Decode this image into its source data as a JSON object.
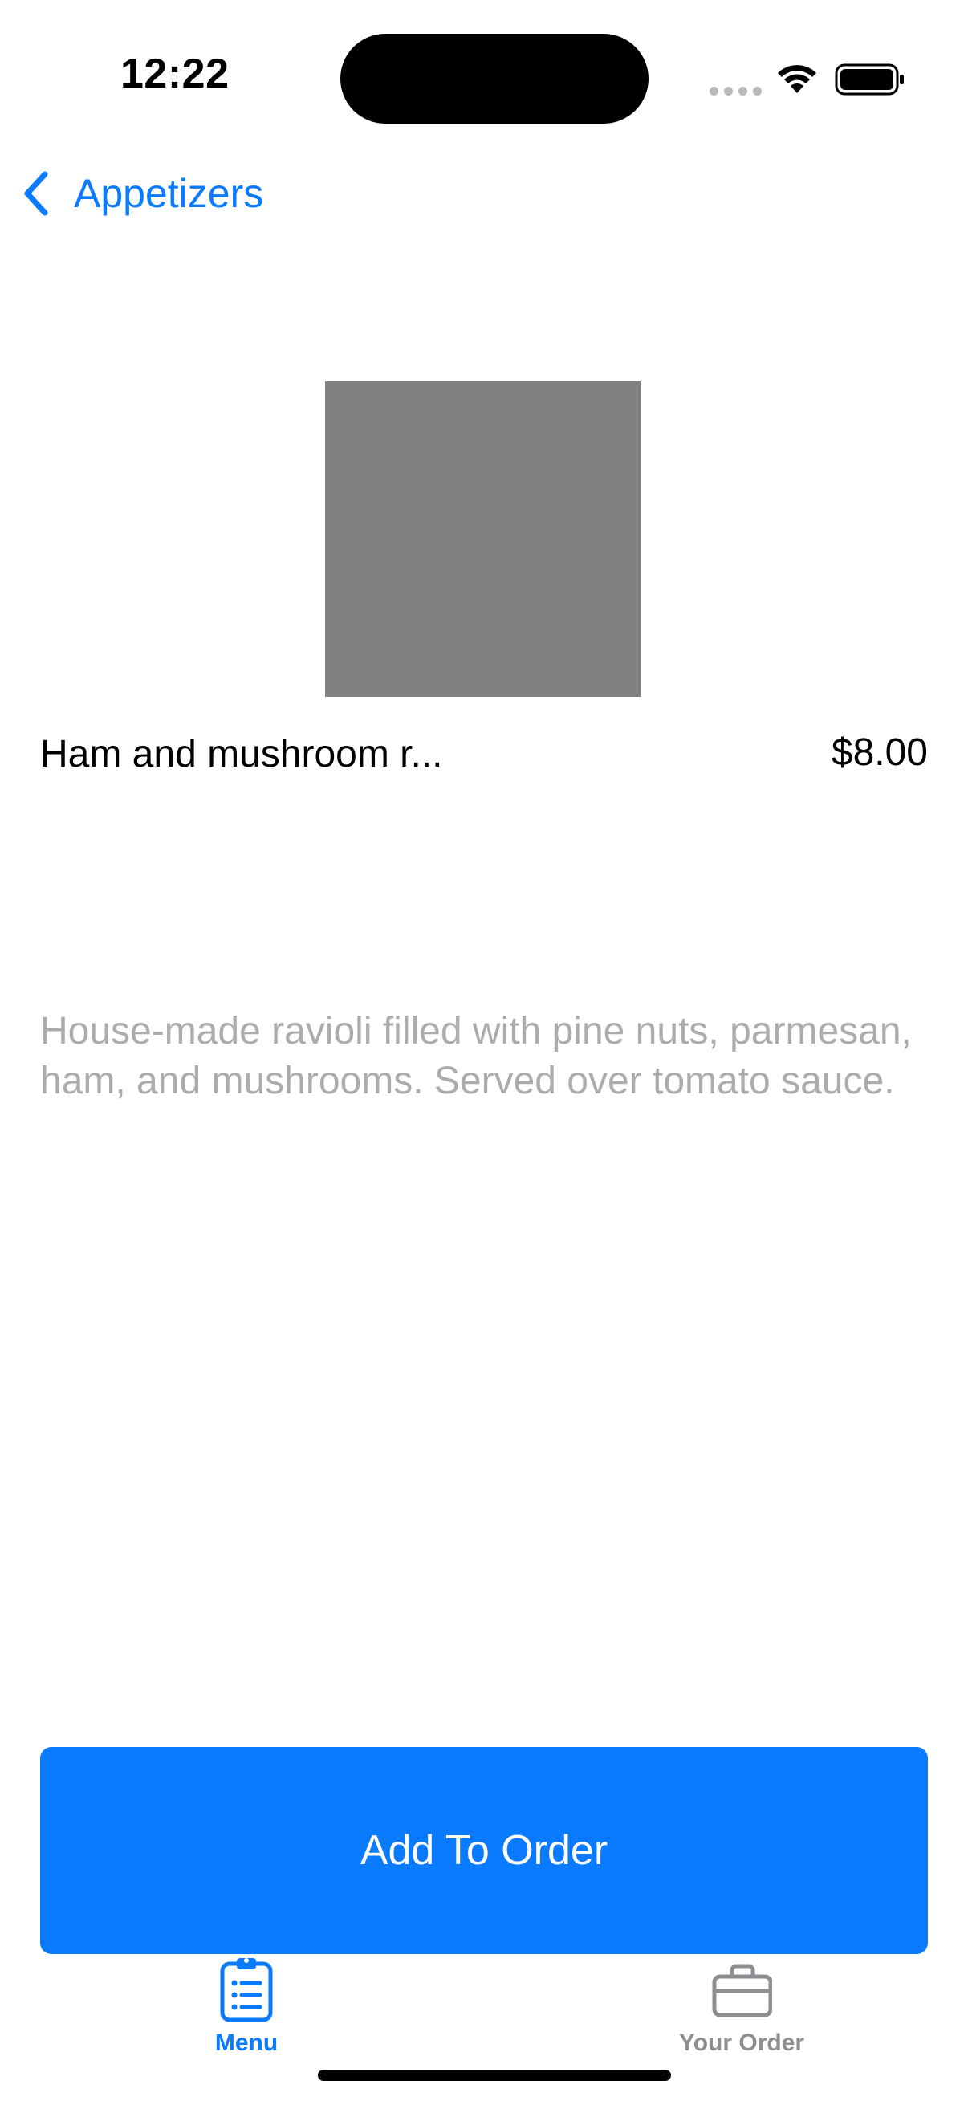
{
  "status_bar": {
    "time": "12:22"
  },
  "nav": {
    "back_label": "Appetizers"
  },
  "product": {
    "name": "Ham and mushroom r...",
    "price": "$8.00",
    "description": "House-made ravioli filled with pine nuts, parmesan, ham, and mushrooms. Served over tomato sauce."
  },
  "actions": {
    "add_label": "Add To Order"
  },
  "tab_bar": {
    "tabs": [
      {
        "label": "Menu",
        "icon": "clipboard-list-icon",
        "selected": true
      },
      {
        "label": "Your Order",
        "icon": "briefcase-icon",
        "selected": false
      }
    ]
  },
  "colors": {
    "accent": "#0a7aff",
    "placeholder_image": "#808080",
    "description_text": "#acacb0",
    "inactive_tab": "#8e8e93"
  }
}
